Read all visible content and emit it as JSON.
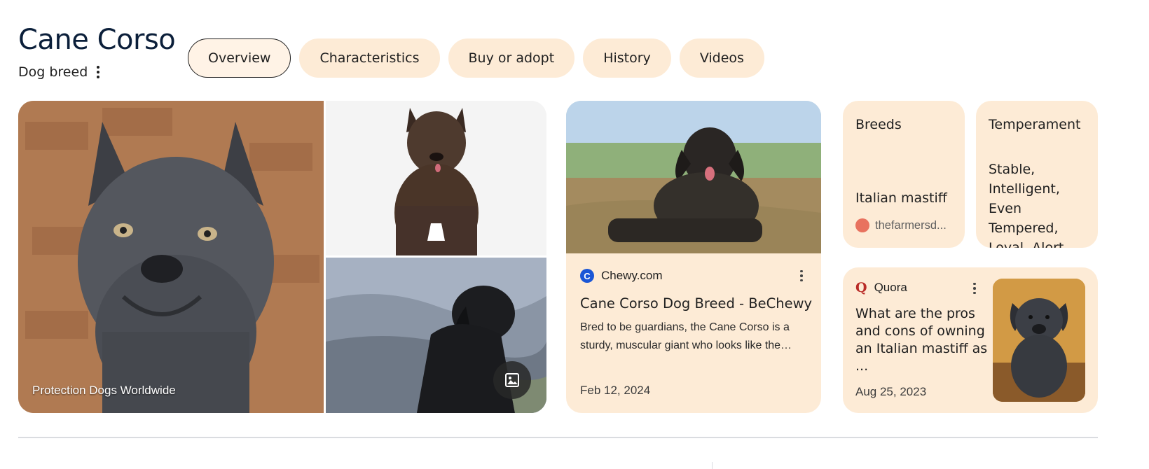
{
  "header": {
    "title": "Cane Corso",
    "subtitle": "Dog breed"
  },
  "tabs": [
    {
      "label": "Overview",
      "active": true
    },
    {
      "label": "Characteristics",
      "active": false
    },
    {
      "label": "Buy or adopt",
      "active": false
    },
    {
      "label": "History",
      "active": false
    },
    {
      "label": "Videos",
      "active": false
    }
  ],
  "collage": {
    "caption": "Protection Dogs Worldwide"
  },
  "chewy": {
    "source": "Chewy.com",
    "title": "Cane Corso Dog Breed - BeChewy",
    "snippet": "Bred to be guardians, the Cane Corso is a sturdy, muscular giant who looks like the…",
    "date": "Feb 12, 2024"
  },
  "breeds": {
    "label": "Breeds",
    "value": "Italian mastiff",
    "source": "thefarmersd..."
  },
  "temperament": {
    "label": "Temperament",
    "value": "Stable, Intelligent, Even Tempered, Loyal, Alert,..."
  },
  "quora": {
    "source": "Quora",
    "title": "What are the pros and cons of owning an Italian mastiff as ...",
    "date": "Aug 25, 2023"
  },
  "colors": {
    "card_bg": "#fdebd6",
    "title_color": "#0b1f3a",
    "quora_red": "#b92b27",
    "chewy_blue": "#1a56d6"
  }
}
